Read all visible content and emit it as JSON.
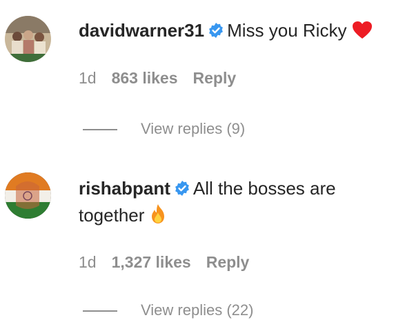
{
  "comments": [
    {
      "username": "davidwarner31",
      "verified": true,
      "text": "Miss you Ricky",
      "emoji": "red-heart",
      "time": "1d",
      "likes": "863 likes",
      "reply_label": "Reply",
      "view_replies": "View replies (9)"
    },
    {
      "username": "rishabpant",
      "verified": true,
      "text_line1": "All the bosses are",
      "text_line2": "together",
      "emoji": "fire",
      "time": "1d",
      "likes": "1,327 likes",
      "reply_label": "Reply",
      "view_replies": "View replies (22)"
    }
  ],
  "colors": {
    "text": "#262626",
    "secondary": "#8e8e8e",
    "verified_blue": "#3897f0",
    "heart_red": "#ed1c24",
    "fire_orange": "#f7931e"
  }
}
